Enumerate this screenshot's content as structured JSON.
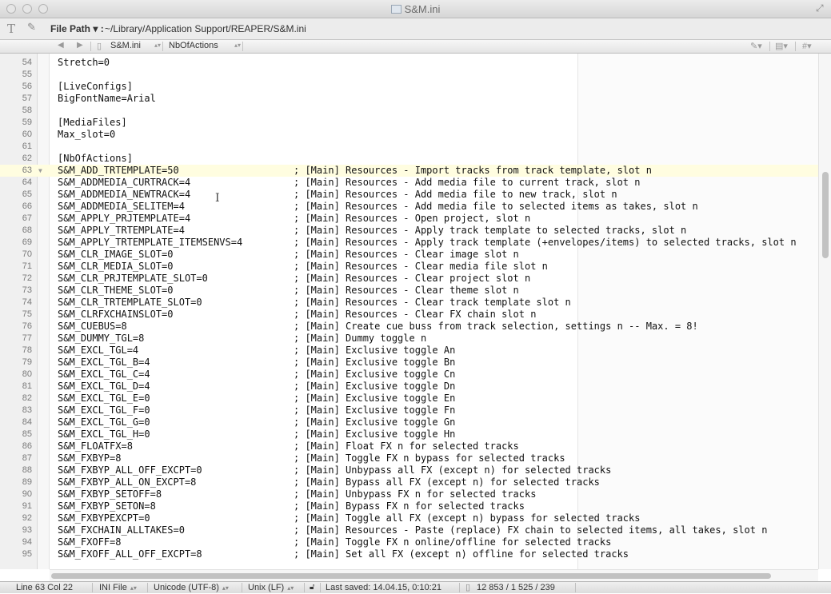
{
  "window": {
    "title": "S&M.ini"
  },
  "pathbar": {
    "label": "File Path ▾ :",
    "value": "~/Library/Application Support/REAPER/S&M.ini"
  },
  "navbar": {
    "file": "S&M.ini",
    "section": "NbOfActions"
  },
  "editor": {
    "lines": [
      {
        "n": "54",
        "code": "Stretch=0",
        "comment": ""
      },
      {
        "n": "55",
        "code": "",
        "comment": ""
      },
      {
        "n": "56",
        "code": "[LiveConfigs]",
        "comment": ""
      },
      {
        "n": "57",
        "code": "BigFontName=Arial",
        "comment": ""
      },
      {
        "n": "58",
        "code": "",
        "comment": ""
      },
      {
        "n": "59",
        "code": "[MediaFiles]",
        "comment": ""
      },
      {
        "n": "60",
        "code": "Max_slot=0",
        "comment": ""
      },
      {
        "n": "61",
        "code": "",
        "comment": ""
      },
      {
        "n": "62",
        "code": "[NbOfActions]",
        "comment": ""
      },
      {
        "n": "63",
        "code": "S&M_ADD_TRTEMPLATE=50",
        "comment": "; [Main] Resources - Import tracks from track template, slot n"
      },
      {
        "n": "64",
        "code": "S&M_ADDMEDIA_CURTRACK=4",
        "comment": "; [Main] Resources - Add media file to current track, slot n"
      },
      {
        "n": "65",
        "code": "S&M_ADDMEDIA_NEWTRACK=4",
        "comment": "; [Main] Resources - Add media file to new track, slot n"
      },
      {
        "n": "66",
        "code": "S&M_ADDMEDIA_SELITEM=4",
        "comment": "; [Main] Resources - Add media file to selected items as takes, slot n"
      },
      {
        "n": "67",
        "code": "S&M_APPLY_PRJTEMPLATE=4",
        "comment": "; [Main] Resources - Open project, slot n"
      },
      {
        "n": "68",
        "code": "S&M_APPLY_TRTEMPLATE=4",
        "comment": "; [Main] Resources - Apply track template to selected tracks, slot n"
      },
      {
        "n": "69",
        "code": "S&M_APPLY_TRTEMPLATE_ITEMSENVS=4",
        "comment": "; [Main] Resources - Apply track template (+envelopes/items) to selected tracks, slot n"
      },
      {
        "n": "70",
        "code": "S&M_CLR_IMAGE_SLOT=0",
        "comment": "; [Main] Resources - Clear image slot n"
      },
      {
        "n": "71",
        "code": "S&M_CLR_MEDIA_SLOT=0",
        "comment": "; [Main] Resources - Clear media file slot n"
      },
      {
        "n": "72",
        "code": "S&M_CLR_PRJTEMPLATE_SLOT=0",
        "comment": "; [Main] Resources - Clear project slot n"
      },
      {
        "n": "73",
        "code": "S&M_CLR_THEME_SLOT=0",
        "comment": "; [Main] Resources - Clear theme slot n"
      },
      {
        "n": "74",
        "code": "S&M_CLR_TRTEMPLATE_SLOT=0",
        "comment": "; [Main] Resources - Clear track template slot n"
      },
      {
        "n": "75",
        "code": "S&M_CLRFXCHAINSLOT=0",
        "comment": "; [Main] Resources - Clear FX chain slot n"
      },
      {
        "n": "76",
        "code": "S&M_CUEBUS=8",
        "comment": "; [Main] Create cue buss from track selection, settings n -- Max. = 8!"
      },
      {
        "n": "77",
        "code": "S&M_DUMMY_TGL=8",
        "comment": "; [Main] Dummy toggle n"
      },
      {
        "n": "78",
        "code": "S&M_EXCL_TGL=4",
        "comment": "; [Main] Exclusive toggle An"
      },
      {
        "n": "79",
        "code": "S&M_EXCL_TGL_B=4",
        "comment": "; [Main] Exclusive toggle Bn"
      },
      {
        "n": "80",
        "code": "S&M_EXCL_TGL_C=4",
        "comment": "; [Main] Exclusive toggle Cn"
      },
      {
        "n": "81",
        "code": "S&M_EXCL_TGL_D=4",
        "comment": "; [Main] Exclusive toggle Dn"
      },
      {
        "n": "82",
        "code": "S&M_EXCL_TGL_E=0",
        "comment": "; [Main] Exclusive toggle En"
      },
      {
        "n": "83",
        "code": "S&M_EXCL_TGL_F=0",
        "comment": "; [Main] Exclusive toggle Fn"
      },
      {
        "n": "84",
        "code": "S&M_EXCL_TGL_G=0",
        "comment": "; [Main] Exclusive toggle Gn"
      },
      {
        "n": "85",
        "code": "S&M_EXCL_TGL_H=0",
        "comment": "; [Main] Exclusive toggle Hn"
      },
      {
        "n": "86",
        "code": "S&M_FLOATFX=8",
        "comment": "; [Main] Float FX n for selected tracks"
      },
      {
        "n": "87",
        "code": "S&M_FXBYP=8",
        "comment": "; [Main] Toggle FX n bypass for selected tracks"
      },
      {
        "n": "88",
        "code": "S&M_FXBYP_ALL_OFF_EXCPT=0",
        "comment": "; [Main] Unbypass all FX (except n) for selected tracks"
      },
      {
        "n": "89",
        "code": "S&M_FXBYP_ALL_ON_EXCPT=8",
        "comment": "; [Main] Bypass all FX (except n) for selected tracks"
      },
      {
        "n": "90",
        "code": "S&M_FXBYP_SETOFF=8",
        "comment": "; [Main] Unbypass FX n for selected tracks"
      },
      {
        "n": "91",
        "code": "S&M_FXBYP_SETON=8",
        "comment": "; [Main] Bypass FX n for selected tracks"
      },
      {
        "n": "92",
        "code": "S&M_FXBYPEXCPT=0",
        "comment": "; [Main] Toggle all FX (except n) bypass for selected tracks"
      },
      {
        "n": "93",
        "code": "S&M_FXCHAIN_ALLTAKES=0",
        "comment": "; [Main] Resources - Paste (replace) FX chain to selected items, all takes, slot n"
      },
      {
        "n": "94",
        "code": "S&M_FXOFF=8",
        "comment": "; [Main] Toggle FX n online/offline for selected tracks"
      },
      {
        "n": "95",
        "code": "S&M_FXOFF_ALL_OFF_EXCPT=8",
        "comment": "; [Main] Set all FX (except n) offline for selected tracks"
      }
    ]
  },
  "statusbar": {
    "position": "Line 63 Col 22",
    "syntax": "INI File",
    "encoding": "Unicode (UTF-8)",
    "line_endings": "Unix (LF)",
    "last_saved": "Last saved: 14.04.15, 0:10:21",
    "counts": "12 853 / 1 525 / 239"
  }
}
